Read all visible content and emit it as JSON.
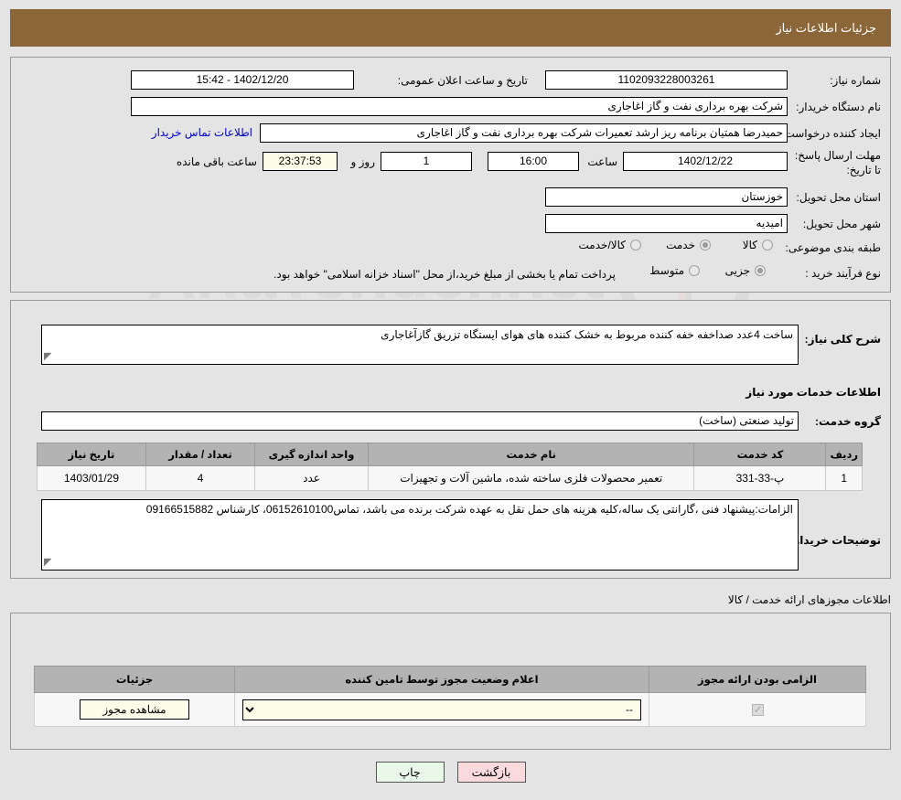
{
  "header": {
    "title": "جزئیات اطلاعات نیاز"
  },
  "watermark": {
    "text": "AriaTender.net"
  },
  "top_section": {
    "need_number_label": "شماره نیاز:",
    "need_number_value": "1102093228003261",
    "announce_label": "تاریخ و ساعت اعلان عمومی:",
    "announce_value": "1402/12/20 - 15:42",
    "buyer_org_label": "نام دستگاه خریدار:",
    "buyer_org_value": "شرکت بهره برداری نفت و گاز اغاجاری",
    "creator_label": "ایجاد کننده درخواست:",
    "creator_value": "حمیدرضا همتیان برنامه ریز ارشد تعمیرات شرکت بهره برداری نفت و گاز اغاجاری",
    "contact_link": "اطلاعات تماس خریدار",
    "deadline_label": "مهلت ارسال پاسخ: تا تاریخ:",
    "deadline_date": "1402/12/22",
    "deadline_hour_label": "ساعت",
    "deadline_hour": "16:00",
    "days_value": "1",
    "days_label": "روز و",
    "countdown": "23:37:53",
    "remaining_label": "ساعت باقی مانده",
    "province_label": "استان محل تحویل:",
    "province_value": "خوزستان",
    "city_label": "شهر محل تحویل:",
    "city_value": "امیدیه",
    "category_label": "طبقه بندی موضوعی:",
    "category_options": [
      {
        "label": "کالا",
        "selected": false
      },
      {
        "label": "خدمت",
        "selected": true
      },
      {
        "label": "کالا/خدمت",
        "selected": false
      }
    ],
    "process_label": "نوع فرآیند خرید :",
    "process_options": [
      {
        "label": "جزیی",
        "selected": true
      },
      {
        "label": "متوسط",
        "selected": false
      }
    ],
    "process_note": "پرداخت تمام یا بخشی از مبلغ خرید،از محل \"اسناد خزانه اسلامی\" خواهد بود."
  },
  "mid_section": {
    "summary_label": "شرح کلی نیاز:",
    "summary_value": "ساخت 4عدد صداخفه خفه کننده مربوط به خشک کننده های هوای ایستگاه تزریق گازآغاجاری",
    "services_heading": "اطلاعات خدمات مورد نیاز",
    "service_group_label": "گروه خدمت:",
    "service_group_value": "تولید صنعتی (ساخت)",
    "table": {
      "headers": [
        "ردیف",
        "کد خدمت",
        "نام خدمت",
        "واحد اندازه گیری",
        "تعداد / مقدار",
        "تاریخ نیاز"
      ],
      "rows": [
        {
          "row": "1",
          "code": "پ-33-331",
          "name": "تعمیر محصولات فلزی ساخته شده، ماشین آلات و تجهیزات",
          "unit": "عدد",
          "qty": "4",
          "date": "1403/01/29"
        }
      ]
    },
    "buyer_notes_label": "توضیحات خریدار:",
    "buyer_notes_value": "الزامات:پیشنهاد فنی ،گارانتی یک ساله،کلیه هزینه های حمل نقل به عهده شرکت برنده می باشد، تماس06152610100، کارشناس 09166515882"
  },
  "permit_section": {
    "caption": "اطلاعات مجوزهای ارائه خدمت / کالا",
    "headers": [
      "الزامی بودن ارائه مجوز",
      "اعلام وضعیت مجوز توسط تامین کننده",
      "جزئیات"
    ],
    "rows": [
      {
        "required": true,
        "status_selected": "--",
        "status_options": [
          "--"
        ],
        "detail_button": "مشاهده مجوز"
      }
    ]
  },
  "footer": {
    "print_label": "چاپ",
    "back_label": "بازگشت"
  }
}
